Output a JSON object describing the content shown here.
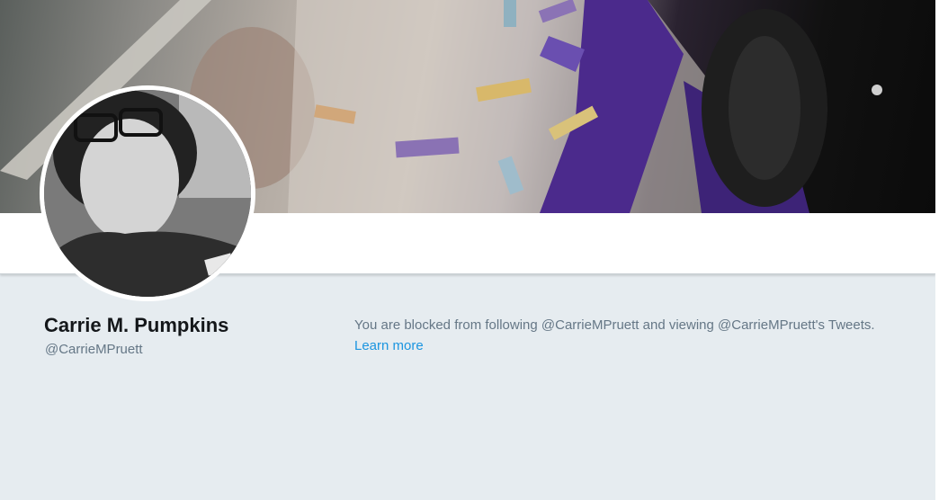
{
  "profile": {
    "name": "Carrie M. Pumpkins",
    "handle": "@CarrieMPruett"
  },
  "blocked": {
    "message": "You are blocked from following @CarrieMPruett and viewing @CarrieMPruett's Tweets.",
    "learn_more": "Learn more"
  },
  "colors": {
    "page_background": "#e6ecf0",
    "link": "#1b95e0",
    "muted_text": "#657786",
    "name_text": "#14171a"
  }
}
